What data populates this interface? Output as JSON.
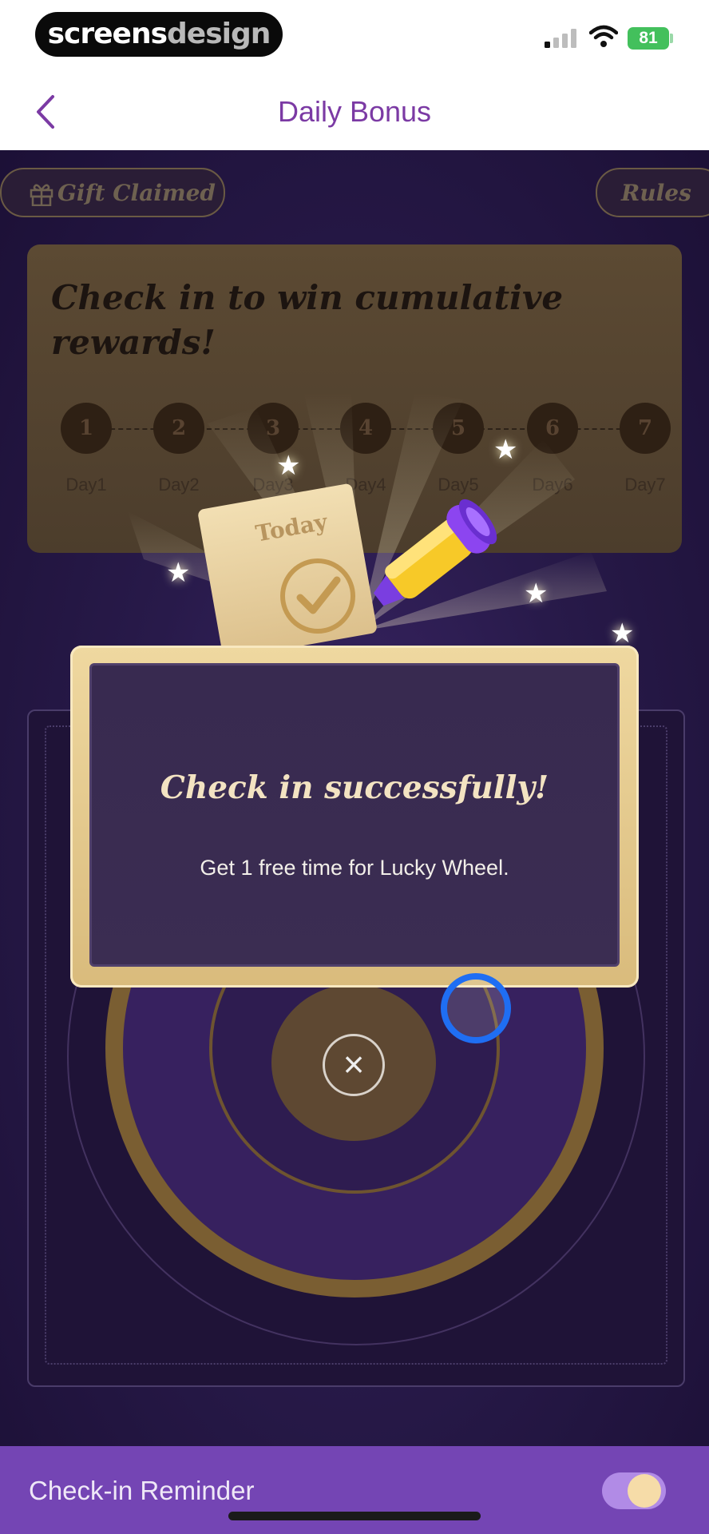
{
  "status_bar": {
    "brand_part1": "screens",
    "brand_part2": "design",
    "battery": "81"
  },
  "nav": {
    "title": "Daily Bonus"
  },
  "header_buttons": {
    "gift_claimed": "Gift Claimed",
    "rules": "Rules"
  },
  "checkin_card": {
    "title": "Check in to win cumulative rewards!",
    "days": [
      {
        "num": "1",
        "label": "Day1"
      },
      {
        "num": "2",
        "label": "Day2"
      },
      {
        "num": "3",
        "label": "Day3"
      },
      {
        "num": "4",
        "label": "Day4"
      },
      {
        "num": "5",
        "label": "Day5"
      },
      {
        "num": "6",
        "label": "Day6"
      },
      {
        "num": "7",
        "label": "Day7"
      }
    ]
  },
  "illustration": {
    "today_label": "Today"
  },
  "modal": {
    "title": "Check in successfully!",
    "message": "Get 1 free time for Lucky Wheel.",
    "close_symbol": "×"
  },
  "bottom_bar": {
    "label": "Check-in Reminder",
    "toggle_on": true
  },
  "colors": {
    "accent_purple": "#7b3aa4",
    "bottom_bar": "#7445b4",
    "gold": "#e6cb8f",
    "battery_green": "#43c05c"
  },
  "icons": [
    "back-chevron-icon",
    "gift-icon",
    "signal-icon",
    "wifi-icon",
    "battery-icon",
    "close-icon",
    "check-icon",
    "marker-icon",
    "star-icon"
  ]
}
